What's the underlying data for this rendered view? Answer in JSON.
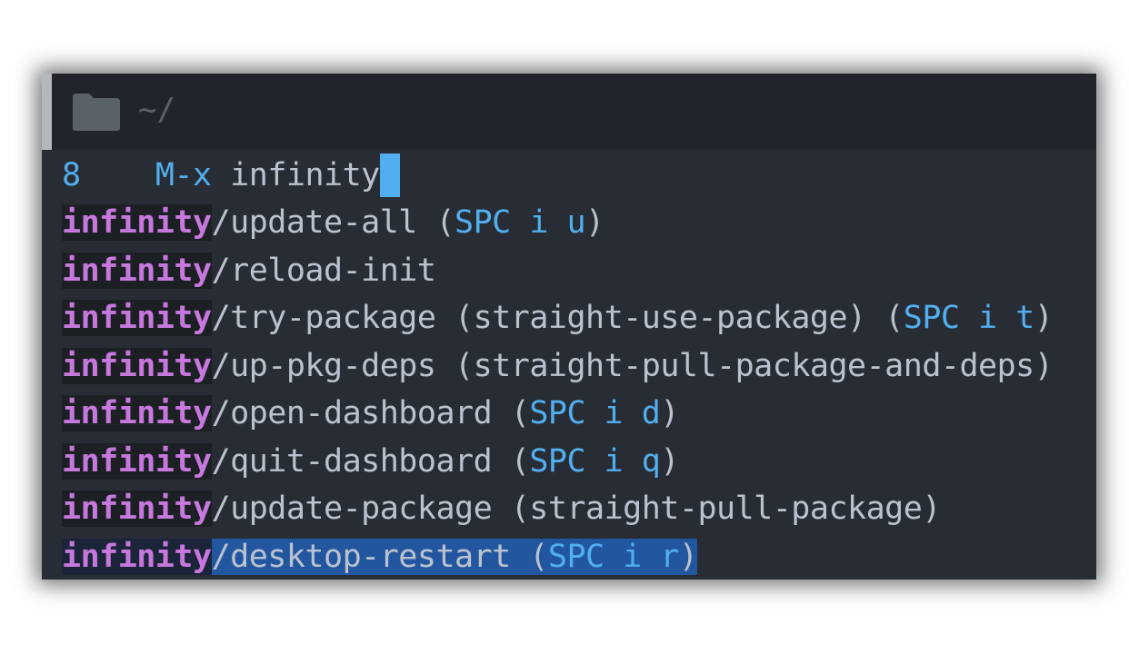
{
  "header": {
    "path": "~/",
    "folder_icon": "folder-icon"
  },
  "minibuffer": {
    "count": "8",
    "prompt": "M-x",
    "input": "infinity"
  },
  "candidates": [
    {
      "prefix": "infinity",
      "name": "/update-all",
      "extra": "",
      "keys": "SPC i u",
      "selected": false
    },
    {
      "prefix": "infinity",
      "name": "/reload-init",
      "extra": "",
      "keys": "",
      "selected": false
    },
    {
      "prefix": "infinity",
      "name": "/try-package",
      "extra": "(straight-use-package)",
      "keys": "SPC i t",
      "selected": false
    },
    {
      "prefix": "infinity",
      "name": "/up-pkg-deps",
      "extra": "(straight-pull-package-and-deps)",
      "keys": "",
      "selected": false
    },
    {
      "prefix": "infinity",
      "name": "/open-dashboard",
      "extra": "",
      "keys": "SPC i d",
      "selected": false
    },
    {
      "prefix": "infinity",
      "name": "/quit-dashboard",
      "extra": "",
      "keys": "SPC i q",
      "selected": false
    },
    {
      "prefix": "infinity",
      "name": "/update-package",
      "extra": "(straight-pull-package)",
      "keys": "",
      "selected": false
    },
    {
      "prefix": "infinity",
      "name": "/desktop-restart",
      "extra": "",
      "keys": "SPC i r",
      "selected": true
    }
  ],
  "colors": {
    "background": "#282c34",
    "header": "#21242b",
    "match": "#c678dd",
    "keybinding": "#51afef",
    "selection": "#2257a0",
    "text": "#bbc2cf"
  }
}
